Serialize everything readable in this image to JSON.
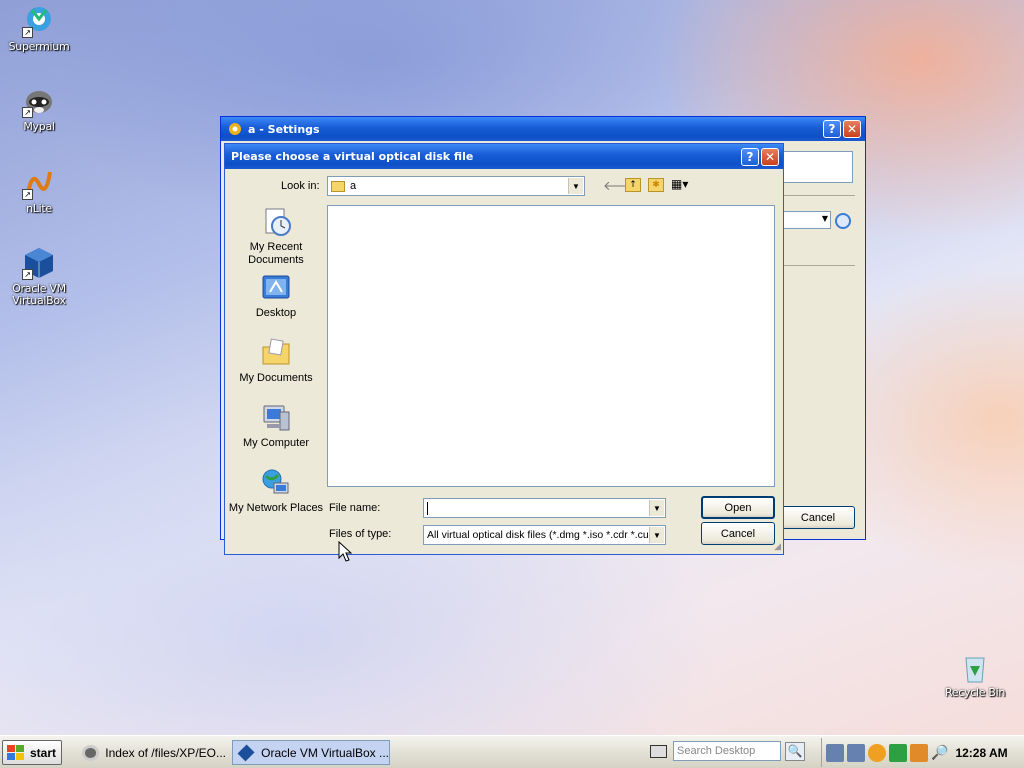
{
  "desktop": {
    "icons": [
      {
        "label": "Supermium"
      },
      {
        "label": "Mypal"
      },
      {
        "label": "nLite"
      },
      {
        "label": "Oracle VM VirtualBox"
      },
      {
        "label": "Recycle Bin"
      }
    ]
  },
  "settings_window": {
    "title": "a - Settings",
    "cancel_label": "Cancel"
  },
  "file_dialog": {
    "title": "Please choose a virtual optical disk file",
    "look_in_label": "Look in:",
    "look_in_value": "a",
    "places": [
      {
        "label": "My Recent Documents"
      },
      {
        "label": "Desktop"
      },
      {
        "label": "My Documents"
      },
      {
        "label": "My Computer"
      },
      {
        "label": "My Network Places"
      }
    ],
    "file_name_label": "File name:",
    "file_name_value": "",
    "files_of_type_label": "Files of type:",
    "files_of_type_value": "All virtual optical disk files (*.dmg *.iso *.cdr *.cue",
    "open_label": "Open",
    "cancel_label": "Cancel"
  },
  "taskbar": {
    "start_label": "start",
    "tasks": [
      {
        "label": "Index of /files/XP/EO..."
      },
      {
        "label": "Oracle VM VirtualBox ..."
      }
    ],
    "search_placeholder": "Search Desktop",
    "clock": "12:28 AM"
  },
  "colors": {
    "title_blue": "#0d4fc6",
    "dialog_bg": "#ece9d8",
    "active_task": "#c5d3f2"
  }
}
